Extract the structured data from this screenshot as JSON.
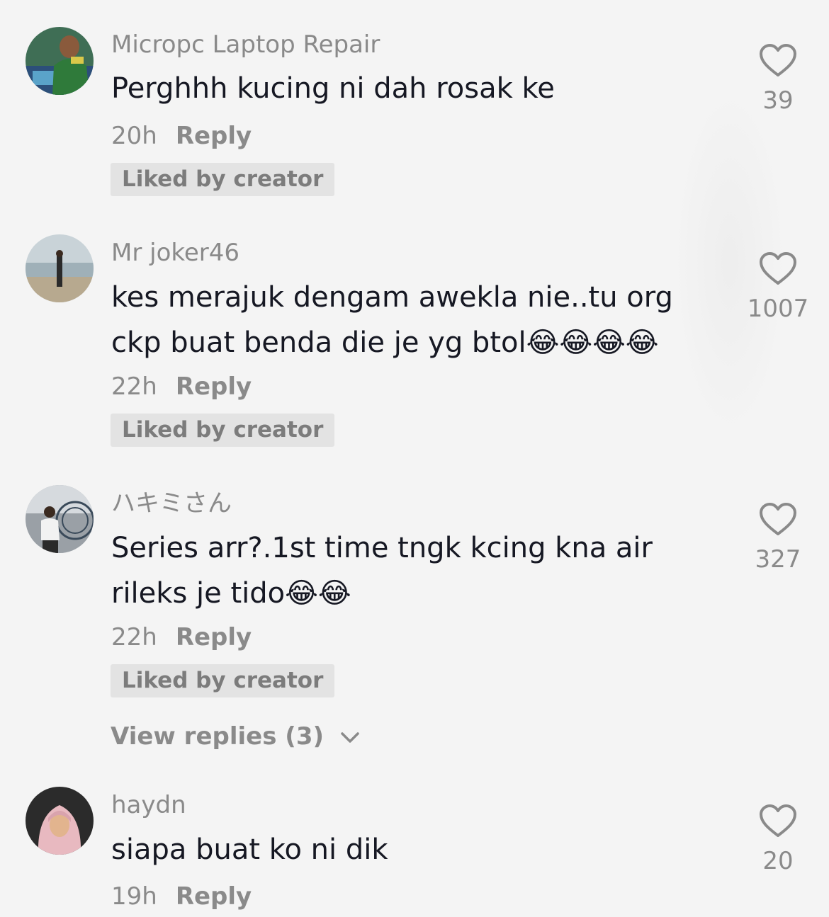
{
  "comments": [
    {
      "author": "Micropc Laptop Repair",
      "text": "Perghhh kucing ni dah rosak ke",
      "time": "20h",
      "reply_label": "Reply",
      "badge": "Liked by creator",
      "likes": "39",
      "avatar_icon": "avatar-photo"
    },
    {
      "author": "Mr joker46",
      "text": "kes merajuk dengam awekla nie..tu org ckp buat benda die je yg btol😂😂😂😂",
      "time": "22h",
      "reply_label": "Reply",
      "badge": "Liked by creator",
      "likes": "1007",
      "avatar_icon": "avatar-photo"
    },
    {
      "author": "ハキミさん",
      "text": "Series arr?.1st time tngk kcing kna air rileks je tido😂😂",
      "time": "22h",
      "reply_label": "Reply",
      "badge": "Liked by creator",
      "likes": "327",
      "view_replies": "View replies (3)",
      "avatar_icon": "avatar-photo"
    },
    {
      "author": "haydn",
      "text": "siapa buat ko ni dik",
      "time": "19h",
      "reply_label": "Reply",
      "likes": "20",
      "avatar_icon": "avatar-photo"
    }
  ],
  "icons": {
    "like": "heart-outline-icon",
    "expand": "chevron-down-icon"
  },
  "colors": {
    "background": "#f4f4f4",
    "text": "#161823",
    "muted": "#8a8a8a",
    "badge_bg": "#e3e3e3"
  }
}
